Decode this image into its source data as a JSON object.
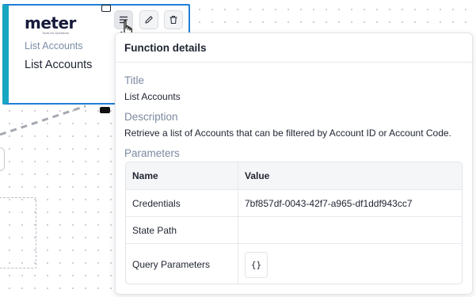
{
  "node": {
    "logo_text": "meter",
    "logo_tagline": "Tools for Operators",
    "subtitle": "List Accounts",
    "title": "List Accounts"
  },
  "toolbar": {
    "details_icon": "list-details-icon",
    "edit_icon": "pencil-icon",
    "delete_icon": "trash-icon"
  },
  "popover": {
    "title": "Function details",
    "title_label": "Title",
    "title_value": "List Accounts",
    "description_label": "Description",
    "description_value": "Retrieve a list of Accounts that can be filtered by Account ID or Account Code.",
    "parameters_label": "Parameters",
    "table": {
      "headers": [
        "Name",
        "Value"
      ],
      "rows": [
        {
          "name": "Credentials",
          "value": "7bf857df-0043-42f7-a965-df1ddf943cc7"
        },
        {
          "name": "State Path",
          "value": ""
        },
        {
          "name": "Query Parameters",
          "value": "{}"
        }
      ]
    }
  },
  "colors": {
    "node_accent": "#17a7c2",
    "node_border": "#1f7fd6",
    "muted_label": "#7d8aa0"
  }
}
